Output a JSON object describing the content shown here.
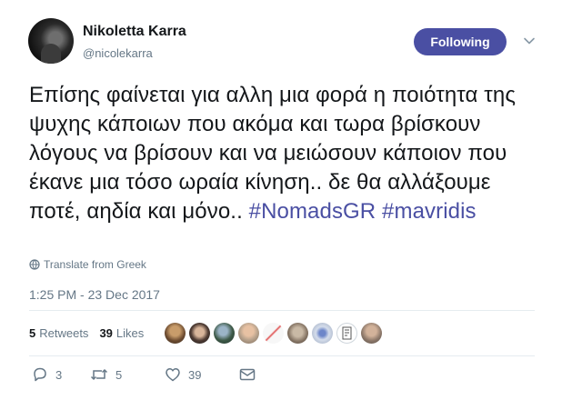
{
  "tweet": {
    "display_name": "Nikoletta Karra",
    "handle": "@nicolekarra",
    "follow_label": "Following",
    "text": "Επίσης φαίνεται για αλλη μια φορά η ποιότητα της ψυχης κάποιων που ακόμα και τωρα βρίσκουν λόγους να βρίσουν και να μειώσουν κάποιον που έκανε μια τόσο ωραία κίνηση.. δε θα αλλάξουμε ποτέ, αηδία και μόνο..",
    "hashtags": [
      "#NomadsGR",
      "#mavridis"
    ],
    "translate_label": "Translate from Greek",
    "timestamp": "1:25 PM - 23 Dec 2017"
  },
  "stats": {
    "retweets_count": "5",
    "retweets_label": "Retweets",
    "likes_count": "39",
    "likes_label": "Likes"
  },
  "actions": {
    "reply_count": "3",
    "retweet_count": "5",
    "like_count": "39"
  },
  "colors": {
    "accent": "#4a4fa3",
    "secondary_text": "#657786",
    "divider": "#e6ecf0"
  }
}
